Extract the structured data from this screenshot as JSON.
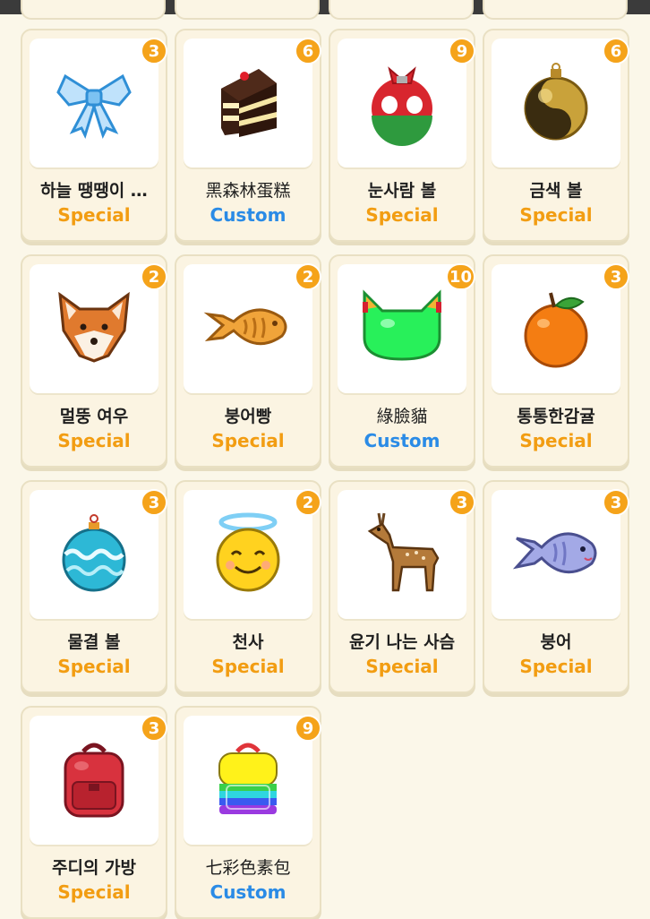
{
  "colors": {
    "special": "#f29d12",
    "custom": "#2a8be6",
    "badge": "#f5a31a",
    "background": "#fbf7e9"
  },
  "items": [
    {
      "name": "하늘 땡땡이 …",
      "count": "3",
      "tag": "Special",
      "icon": "blue-ribbon-bow-icon"
    },
    {
      "name": "黑森林蛋糕",
      "count": "6",
      "tag": "Custom",
      "icon": "black-forest-cake-icon"
    },
    {
      "name": "눈사람 볼",
      "count": "9",
      "tag": "Special",
      "icon": "snowman-ornament-ball-icon"
    },
    {
      "name": "금색 볼",
      "count": "6",
      "tag": "Special",
      "icon": "gold-ornament-ball-icon"
    },
    {
      "name": "멀뚱 여우",
      "count": "2",
      "tag": "Special",
      "icon": "fox-face-icon"
    },
    {
      "name": "붕어빵",
      "count": "2",
      "tag": "Special",
      "icon": "fish-bread-icon"
    },
    {
      "name": "綠臉貓",
      "count": "10",
      "tag": "Custom",
      "icon": "green-cat-face-icon"
    },
    {
      "name": "통통한감귤",
      "count": "3",
      "tag": "Special",
      "icon": "tangerine-icon"
    },
    {
      "name": "물결 볼",
      "count": "3",
      "tag": "Special",
      "icon": "wave-ornament-ball-icon"
    },
    {
      "name": "천사",
      "count": "2",
      "tag": "Special",
      "icon": "angel-smiley-icon"
    },
    {
      "name": "윤기 나는 사슴",
      "count": "3",
      "tag": "Special",
      "icon": "deer-icon"
    },
    {
      "name": "붕어",
      "count": "3",
      "tag": "Special",
      "icon": "blue-fish-icon"
    },
    {
      "name": "주디의 가방",
      "count": "3",
      "tag": "Special",
      "icon": "red-backpack-icon"
    },
    {
      "name": "七彩色素包",
      "count": "9",
      "tag": "Custom",
      "icon": "rainbow-backpack-icon"
    }
  ]
}
